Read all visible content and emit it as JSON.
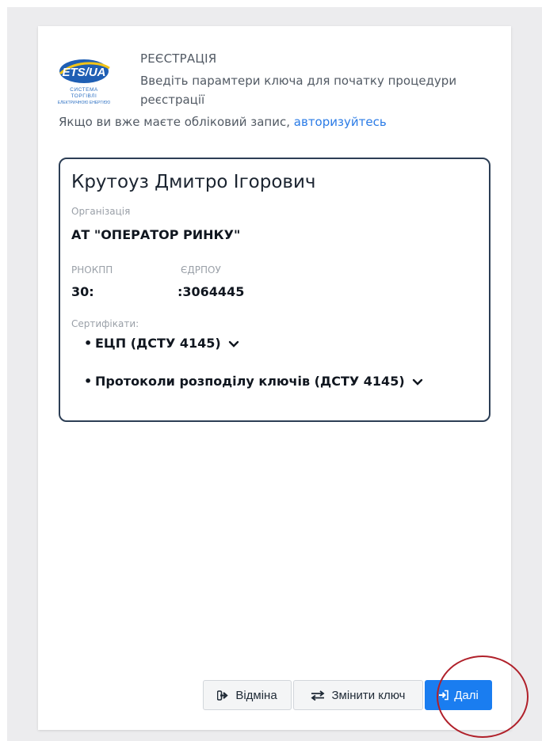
{
  "logo": {
    "text": "ETS/UA",
    "tagline_line1": "СИСТЕМА ТОРГІВЛІ",
    "tagline_line2": "ЕЛЕКТРИЧНОЮ ЕНЕРГІЄЮ"
  },
  "header": {
    "title": "РЕЄСТРАЦІЯ",
    "description": "Введіть парамтери ключа для початку процедури реєстрації"
  },
  "login": {
    "prefix": "Якщо ви вже маєте обліковий запис, ",
    "link": "авторизуйтесь"
  },
  "key_info": {
    "owner": "Крутоуз Дмитро Ігорович",
    "organization_label": "Організація",
    "organization": "АТ \"ОПЕРАТОР РИНКУ\"",
    "rnokpp_label": "РНОКПП",
    "rnokpp": "30:",
    "edrpou_label": "ЄДРПОУ",
    "edrpou": ":3064445",
    "certificates_label": "Сертифікати:",
    "certificates": [
      "ЕЦП (ДСТУ 4145)",
      "Протоколи розподілу ключів (ДСТУ 4145)"
    ]
  },
  "buttons": {
    "cancel": "Відміна",
    "change_key": "Змінити ключ",
    "next": "Далі"
  },
  "colors": {
    "accent": "#1a7df0",
    "link": "#2a7be6",
    "box_border": "#2c3e55",
    "annotation": "#b0202a"
  }
}
